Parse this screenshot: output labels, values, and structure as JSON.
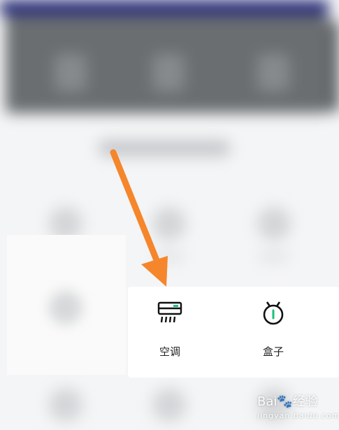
{
  "devices": [
    {
      "label": "空调",
      "icon": "air-conditioner-icon"
    },
    {
      "label": "盒子",
      "icon": "tv-box-icon"
    }
  ],
  "watermark": {
    "brand": "Bai",
    "suffix": "经验",
    "url": "jingyan.baidu.com"
  },
  "colors": {
    "arrow": "#f5862b",
    "accent_green": "#19c27a",
    "banner": "#2a2e7a"
  }
}
